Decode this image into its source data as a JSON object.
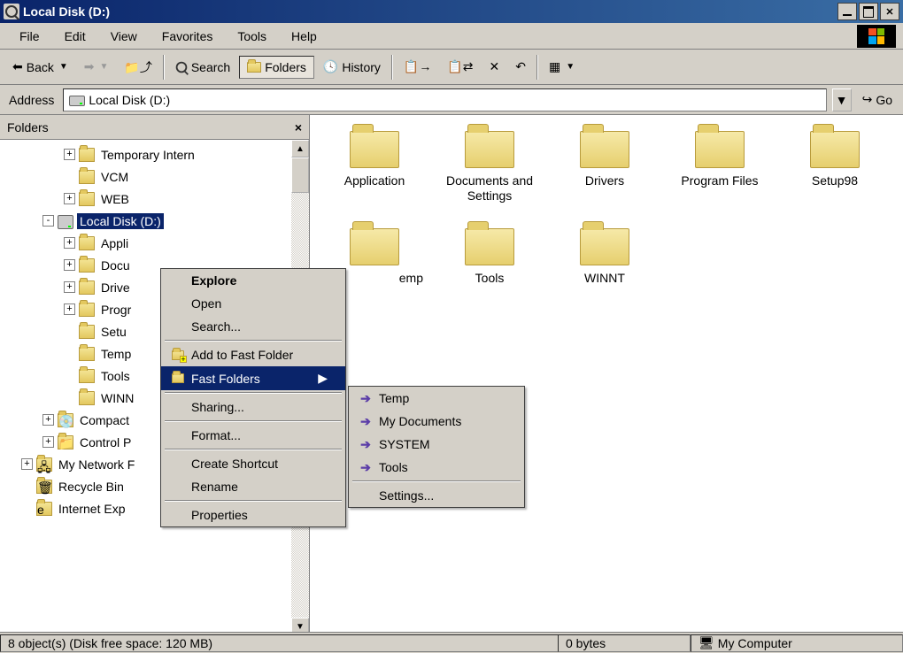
{
  "window": {
    "title": "Local Disk (D:)"
  },
  "menu": [
    "File",
    "Edit",
    "View",
    "Favorites",
    "Tools",
    "Help"
  ],
  "toolbar": {
    "back": "Back",
    "search": "Search",
    "folders": "Folders",
    "history": "History"
  },
  "address": {
    "label": "Address",
    "value": "Local Disk (D:)",
    "go": "Go"
  },
  "folders_pane": {
    "title": "Folders"
  },
  "tree": [
    {
      "d": 3,
      "exp": "+",
      "icon": "folder",
      "label": "Temporary Intern"
    },
    {
      "d": 3,
      "exp": "",
      "icon": "folder",
      "label": "VCM"
    },
    {
      "d": 3,
      "exp": "+",
      "icon": "folder",
      "label": "WEB"
    },
    {
      "d": 2,
      "exp": "-",
      "icon": "disk",
      "label": "Local Disk (D:)",
      "sel": true
    },
    {
      "d": 3,
      "exp": "+",
      "icon": "folder",
      "label": "Appli"
    },
    {
      "d": 3,
      "exp": "+",
      "icon": "folder",
      "label": "Docu"
    },
    {
      "d": 3,
      "exp": "+",
      "icon": "folder",
      "label": "Drive"
    },
    {
      "d": 3,
      "exp": "+",
      "icon": "folder",
      "label": "Progr"
    },
    {
      "d": 3,
      "exp": "",
      "icon": "folder",
      "label": "Setu"
    },
    {
      "d": 3,
      "exp": "",
      "icon": "folder",
      "label": "Temp"
    },
    {
      "d": 3,
      "exp": "",
      "icon": "folder",
      "label": "Tools"
    },
    {
      "d": 3,
      "exp": "",
      "icon": "folder",
      "label": "WINN"
    },
    {
      "d": 2,
      "exp": "+",
      "icon": "cd",
      "label": "Compact"
    },
    {
      "d": 2,
      "exp": "+",
      "icon": "ctrl",
      "label": "Control P"
    },
    {
      "d": 1,
      "exp": "+",
      "icon": "net",
      "label": "My Network F"
    },
    {
      "d": 1,
      "exp": "",
      "icon": "bin",
      "label": "Recycle Bin"
    },
    {
      "d": 1,
      "exp": "",
      "icon": "ie",
      "label": "Internet Exp"
    }
  ],
  "ctx1": [
    {
      "t": "item",
      "label": "Explore",
      "bold": true
    },
    {
      "t": "item",
      "label": "Open"
    },
    {
      "t": "item",
      "label": "Search..."
    },
    {
      "t": "sep"
    },
    {
      "t": "item",
      "label": "Add to Fast Folder",
      "icon": "fastadd"
    },
    {
      "t": "item",
      "label": "Fast Folders",
      "icon": "fastfolder",
      "hi": true,
      "sub": true
    },
    {
      "t": "sep"
    },
    {
      "t": "item",
      "label": "Sharing..."
    },
    {
      "t": "sep"
    },
    {
      "t": "item",
      "label": "Format..."
    },
    {
      "t": "sep"
    },
    {
      "t": "item",
      "label": "Create Shortcut"
    },
    {
      "t": "item",
      "label": "Rename"
    },
    {
      "t": "sep"
    },
    {
      "t": "item",
      "label": "Properties"
    }
  ],
  "ctx2": [
    {
      "t": "item",
      "label": "Temp",
      "arr": true
    },
    {
      "t": "item",
      "label": "My Documents",
      "arr": true
    },
    {
      "t": "item",
      "label": "SYSTEM",
      "arr": true
    },
    {
      "t": "item",
      "label": "Tools",
      "arr": true
    },
    {
      "t": "sep"
    },
    {
      "t": "item",
      "label": "Settings..."
    }
  ],
  "content": [
    "Application",
    "Documents and Settings",
    "Drivers",
    "Program Files",
    "Setup98",
    "Temp",
    "Tools",
    "WINNT"
  ],
  "extra_first": "emp",
  "status": {
    "left": "8 object(s) (Disk free space: 120 MB)",
    "mid": "0 bytes",
    "right": "My Computer"
  }
}
